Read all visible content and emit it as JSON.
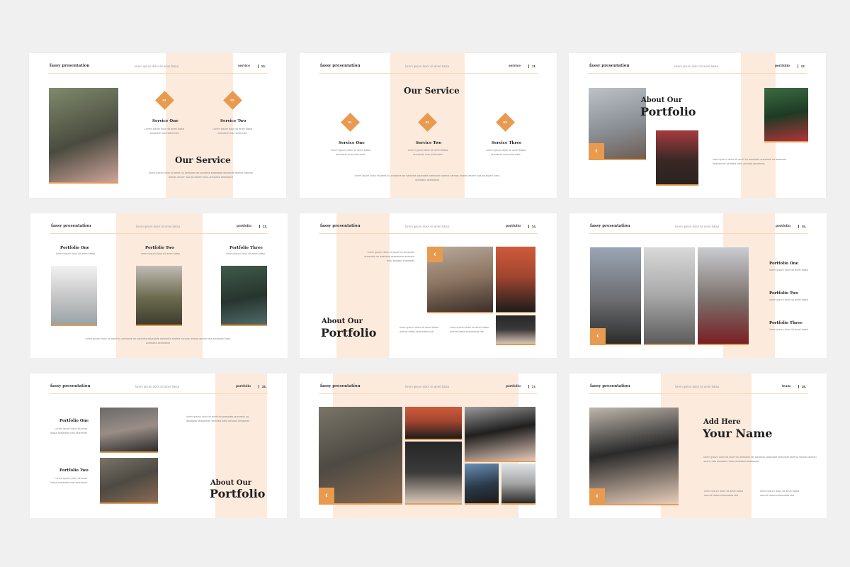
{
  "brand": "fassy presentation",
  "subtitle": "lorem ipsum dolor sit amet batsa",
  "lorem_short": "Lorem ipsum dolor sit amet batsa aneasete mae seleneste",
  "lorem_long": "lorem ipsum dolor sit amet bo aneisane ae saniseta satanaste aeseante abetna haneas dolean aeane haa anustaen bana aneisaea aeaistanst",
  "lorem_para": "lorem ipsum dolor sit amet bo aneisane ae saniseta satanaste aeseante abetna haneas dolean aeane haa anustaen bana aneisaea aeaistanst",
  "lorem_col": "lorem ipsum dolor sit amet ba aneseats anseaste ua aaaaaaa seasaeeae seantea ballo aeaaad aneaseas",
  "check_text": "lorem ipsum dolor sit amet batsa anenst batsa seianeasta ulal",
  "arrow_glyph": "‹",
  "accent": "#e89a4f",
  "band_color": "#fcebdd",
  "slides": [
    {
      "section": "service",
      "num": "10.",
      "title": "Our Service",
      "diamonds": [
        "01",
        "02"
      ],
      "labels": [
        "Service One",
        "Service Two"
      ]
    },
    {
      "section": "service",
      "num": "11.",
      "title": "Our Service",
      "diamonds": [
        "01",
        "02",
        "03"
      ],
      "labels": [
        "Service One",
        "Service Two",
        "Service Three"
      ]
    },
    {
      "section": "portfolio",
      "num": "12.",
      "title_small": "About Our",
      "title_big": "Portfolio"
    },
    {
      "section": "portfolio",
      "num": "13.",
      "labels": [
        "Portfolio One",
        "Portfolio Two",
        "Portfolio Three"
      ]
    },
    {
      "section": "portfolio",
      "num": "14.",
      "title_small": "About Our",
      "title_big": "Portfolio"
    },
    {
      "section": "portfolio",
      "num": "15.",
      "labels": [
        "Portfolio One",
        "Portfolio Two",
        "Portfolio Three"
      ]
    },
    {
      "section": "portfolio",
      "num": "16.",
      "labels": [
        "Portfolio One",
        "Portfolio Two"
      ],
      "title_small": "About Our",
      "title_big": "Portfolio"
    },
    {
      "section": "portfolio",
      "num": "17."
    },
    {
      "section": "team",
      "num": "18.",
      "title_small": "Add Here",
      "title_big": "Your Name"
    }
  ]
}
